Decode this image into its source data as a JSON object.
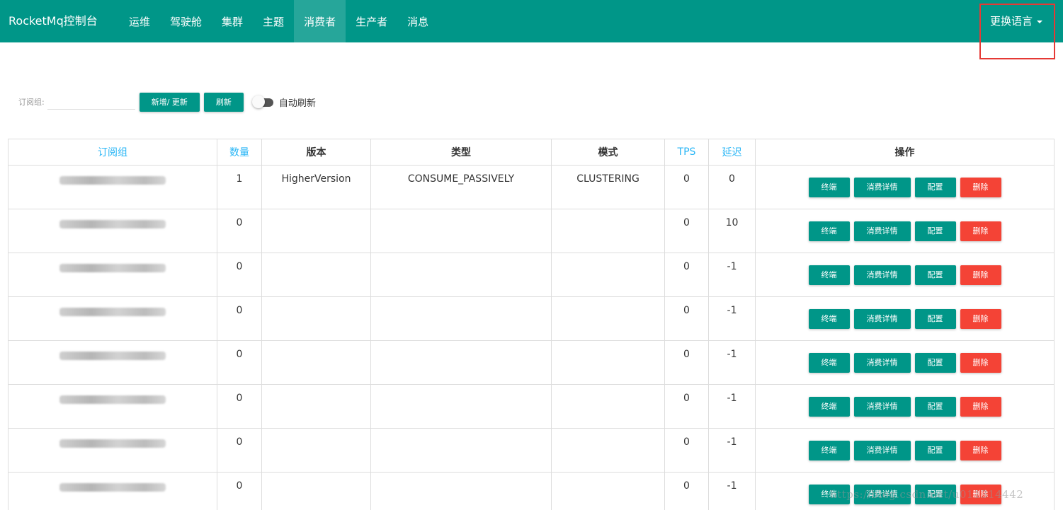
{
  "navbar": {
    "brand": "RocketMq控制台",
    "items": [
      "运维",
      "驾驶舱",
      "集群",
      "主题",
      "消费者",
      "生产者",
      "消息"
    ],
    "active_index": 4,
    "language_label": "更换语言",
    "color": "#009688"
  },
  "toolbar": {
    "filter_label": "订阅组:",
    "filter_value": "",
    "add_update_label": "新增/ 更新",
    "refresh_label": "刷新",
    "auto_refresh_label": "自动刷新",
    "auto_refresh_on": false
  },
  "table": {
    "headers": [
      "订阅组",
      "数量",
      "版本",
      "类型",
      "模式",
      "TPS",
      "延迟",
      "操作"
    ],
    "sortable_headers": [
      true,
      true,
      false,
      false,
      false,
      true,
      true,
      false
    ],
    "rows": [
      {
        "group": "",
        "count": "1",
        "version": "HigherVersion",
        "type": "CONSUME_PASSIVELY",
        "mode": "CLUSTERING",
        "tps": "0",
        "delay": "0"
      },
      {
        "group": "",
        "count": "0",
        "version": "",
        "type": "",
        "mode": "",
        "tps": "0",
        "delay": "10"
      },
      {
        "group": "",
        "count": "0",
        "version": "",
        "type": "",
        "mode": "",
        "tps": "0",
        "delay": "-1"
      },
      {
        "group": "",
        "count": "0",
        "version": "",
        "type": "",
        "mode": "",
        "tps": "0",
        "delay": "-1"
      },
      {
        "group": "",
        "count": "0",
        "version": "",
        "type": "",
        "mode": "",
        "tps": "0",
        "delay": "-1"
      },
      {
        "group": "",
        "count": "0",
        "version": "",
        "type": "",
        "mode": "",
        "tps": "0",
        "delay": "-1"
      },
      {
        "group": "",
        "count": "0",
        "version": "",
        "type": "",
        "mode": "",
        "tps": "0",
        "delay": "-1"
      },
      {
        "group": "",
        "count": "0",
        "version": "",
        "type": "",
        "mode": "",
        "tps": "0",
        "delay": "-1"
      }
    ],
    "action_labels": {
      "terminal": "终端",
      "consume_detail": "消费详情",
      "config": "配置",
      "delete": "删除"
    }
  },
  "colors": {
    "primary": "#009688",
    "danger": "#f44336",
    "link": "#29b6f6",
    "highlight": "#e53935"
  },
  "watermark": "https://blog.csdn.net/u011314442"
}
